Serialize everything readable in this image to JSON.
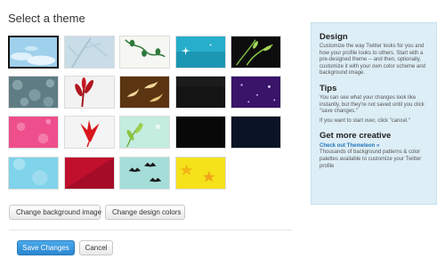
{
  "heading": "Select a theme",
  "themes": [
    {
      "name": "sky-clouds",
      "selected": true
    },
    {
      "name": "grey-branches",
      "selected": false
    },
    {
      "name": "green-vines",
      "selected": false
    },
    {
      "name": "teal-sparkle",
      "selected": false
    },
    {
      "name": "green-grass-dark",
      "selected": false
    },
    {
      "name": "grey-floral-pattern",
      "selected": false
    },
    {
      "name": "red-plant",
      "selected": false
    },
    {
      "name": "brown-birds",
      "selected": false
    },
    {
      "name": "black-texture",
      "selected": false
    },
    {
      "name": "purple-stars",
      "selected": false
    },
    {
      "name": "pink-flowers",
      "selected": false
    },
    {
      "name": "red-leaf",
      "selected": false
    },
    {
      "name": "green-leaves-mint",
      "selected": false
    },
    {
      "name": "solid-black",
      "selected": false
    },
    {
      "name": "navy-dark",
      "selected": false
    },
    {
      "name": "light-blue-pattern",
      "selected": false
    },
    {
      "name": "red-crimson",
      "selected": false
    },
    {
      "name": "birds-on-teal",
      "selected": false
    },
    {
      "name": "yellow-stars",
      "selected": false
    }
  ],
  "buttons": {
    "change_background": "Change background image",
    "change_colors": "Change design colors",
    "save": "Save Changes",
    "cancel": "Cancel"
  },
  "sidebar": {
    "design_title": "Design",
    "design_text": "Customize the way Twitter looks for you and how your profile looks to others. Start with a pre-designed theme -- and then, optionally, customize it with your own color scheme and background image.",
    "tips_title": "Tips",
    "tips_text_1": "You can see what your changes look like instantly, but they're not saved until you click \"save changes.\"",
    "tips_text_2": "If you want to start over, click \"cancel.\"",
    "creative_title": "Get more creative",
    "creative_link": "Check out Themeleon »",
    "creative_text": "Thousands of background patterns & color palettes available to customize your Twitter profile"
  },
  "colors": {
    "accent": "#2a86cf",
    "sidebar_bg": "#ddeef6",
    "link": "#2276bb"
  }
}
